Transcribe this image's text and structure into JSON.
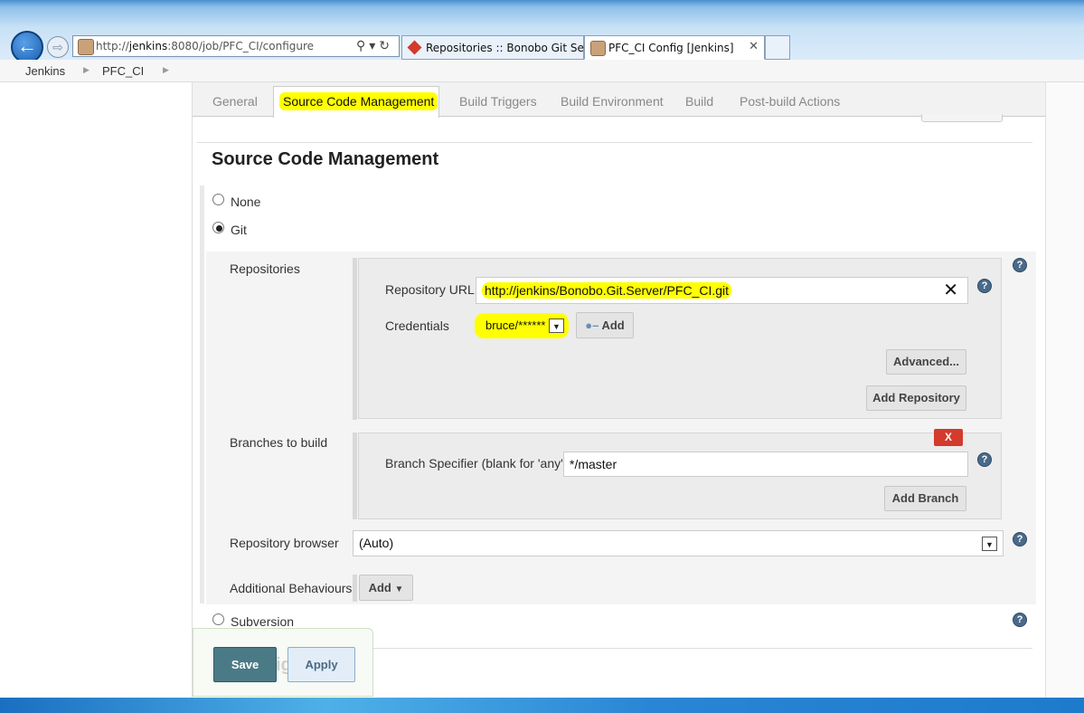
{
  "browser": {
    "url_prefix": "http://",
    "url_host": "jenkins",
    "url_rest": ":8080/job/PFC_CI/configure",
    "tabs": [
      {
        "label": "Repositories :: Bonobo Git Serv..."
      },
      {
        "label": "PFC_CI Config [Jenkins]"
      }
    ]
  },
  "breadcrumb": [
    "Jenkins",
    "PFC_CI"
  ],
  "config_tabs": [
    "General",
    "Source Code Management",
    "Build Triggers",
    "Build Environment",
    "Build",
    "Post-build Actions"
  ],
  "section": {
    "title": "Source Code Management",
    "options": {
      "none": "None",
      "git": "Git",
      "subversion": "Subversion"
    },
    "selected": "Git"
  },
  "git": {
    "repositories_label": "Repositories",
    "repo_url_label": "Repository URL",
    "repo_url_value": "http://jenkins/Bonobo.Git.Server/PFC_CI.git",
    "credentials_label": "Credentials",
    "credentials_value": "bruce/******",
    "add_credentials": "Add",
    "advanced": "Advanced...",
    "add_repository": "Add Repository",
    "branches_label": "Branches to build",
    "delete_branch": "X",
    "branch_spec_label": "Branch Specifier (blank for 'any')",
    "branch_spec_value": "*/master",
    "add_branch": "Add Branch",
    "repo_browser_label": "Repository browser",
    "repo_browser_value": "(Auto)",
    "additional_label": "Additional Behaviours",
    "additional_add": "Add"
  },
  "actions": {
    "save": "Save",
    "apply": "Apply"
  },
  "colors": {
    "highlight": "#ffff00",
    "save_bg": "#4a7a86",
    "delete_red": "#d33b2c"
  }
}
